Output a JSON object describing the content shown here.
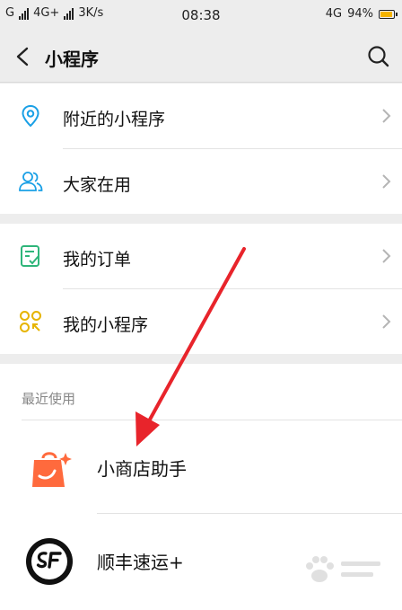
{
  "status_bar": {
    "carrier1": "G",
    "network": "4G+",
    "speed": "3K/s",
    "time": "08:38",
    "network_right": "4G",
    "battery": "94%",
    "battery_level": 0.94
  },
  "nav": {
    "title": "小程序"
  },
  "menu1": [
    {
      "label": "附近的小程序"
    },
    {
      "label": "大家在用"
    }
  ],
  "menu2": [
    {
      "label": "我的订单"
    },
    {
      "label": "我的小程序"
    }
  ],
  "recent": {
    "heading": "最近使用",
    "apps": [
      {
        "name": "小商店助手"
      },
      {
        "name": "顺丰速运+"
      }
    ]
  },
  "colors": {
    "accent_blue": "#1aa0e6",
    "accent_green": "#2fb57a",
    "accent_yellow": "#e6b400",
    "shop_orange": "#ff6a3d",
    "arrow_red": "#e8242b"
  }
}
